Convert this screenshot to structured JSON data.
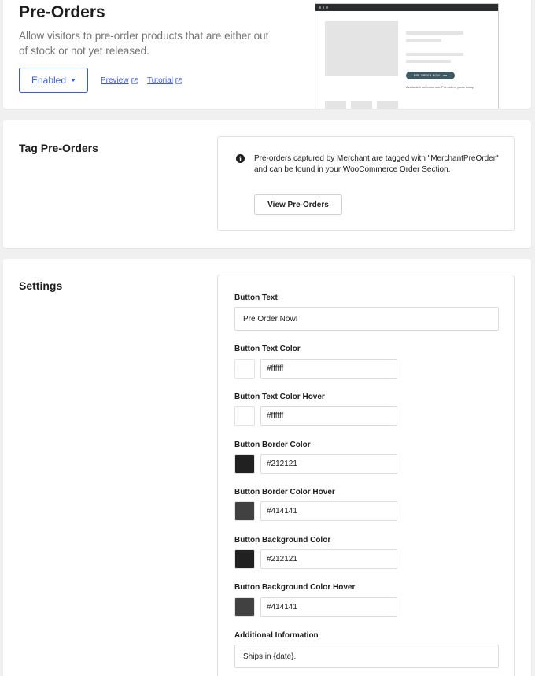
{
  "hero": {
    "title": "Pre-Orders",
    "description": "Allow visitors to pre-order products that are either out of stock or not yet released.",
    "status_button": "Enabled",
    "preview_link": "Preview",
    "tutorial_link": "Tutorial",
    "mockup": {
      "button_label": "PRE ORDER NOW",
      "note": "Available from tomorrow. Pre-orders yours today!"
    }
  },
  "tag_section": {
    "title": "Tag Pre-Orders",
    "info_text": "Pre-orders captured by Merchant are tagged with \"MerchantPreOrder\" and can be found in your WooCommerce Order Section.",
    "view_button": "View Pre-Orders"
  },
  "settings": {
    "title": "Settings",
    "button_text": {
      "label": "Button Text",
      "value": "Pre Order Now!"
    },
    "colors": [
      {
        "label": "Button Text Color",
        "value": "#ffffff",
        "swatch": "#ffffff"
      },
      {
        "label": "Button Text Color Hover",
        "value": "#ffffff",
        "swatch": "#ffffff"
      },
      {
        "label": "Button Border Color",
        "value": "#212121",
        "swatch": "#212121"
      },
      {
        "label": "Button Border Color Hover",
        "value": "#414141",
        "swatch": "#414141"
      },
      {
        "label": "Button Background Color",
        "value": "#212121",
        "swatch": "#212121"
      },
      {
        "label": "Button Background Color Hover",
        "value": "#414141",
        "swatch": "#414141"
      }
    ],
    "additional_info": {
      "label": "Additional Information",
      "value": "Ships in {date}."
    }
  },
  "theme": {
    "accent": "#3858e9",
    "text": "#1e1e1e",
    "muted": "#757575"
  }
}
